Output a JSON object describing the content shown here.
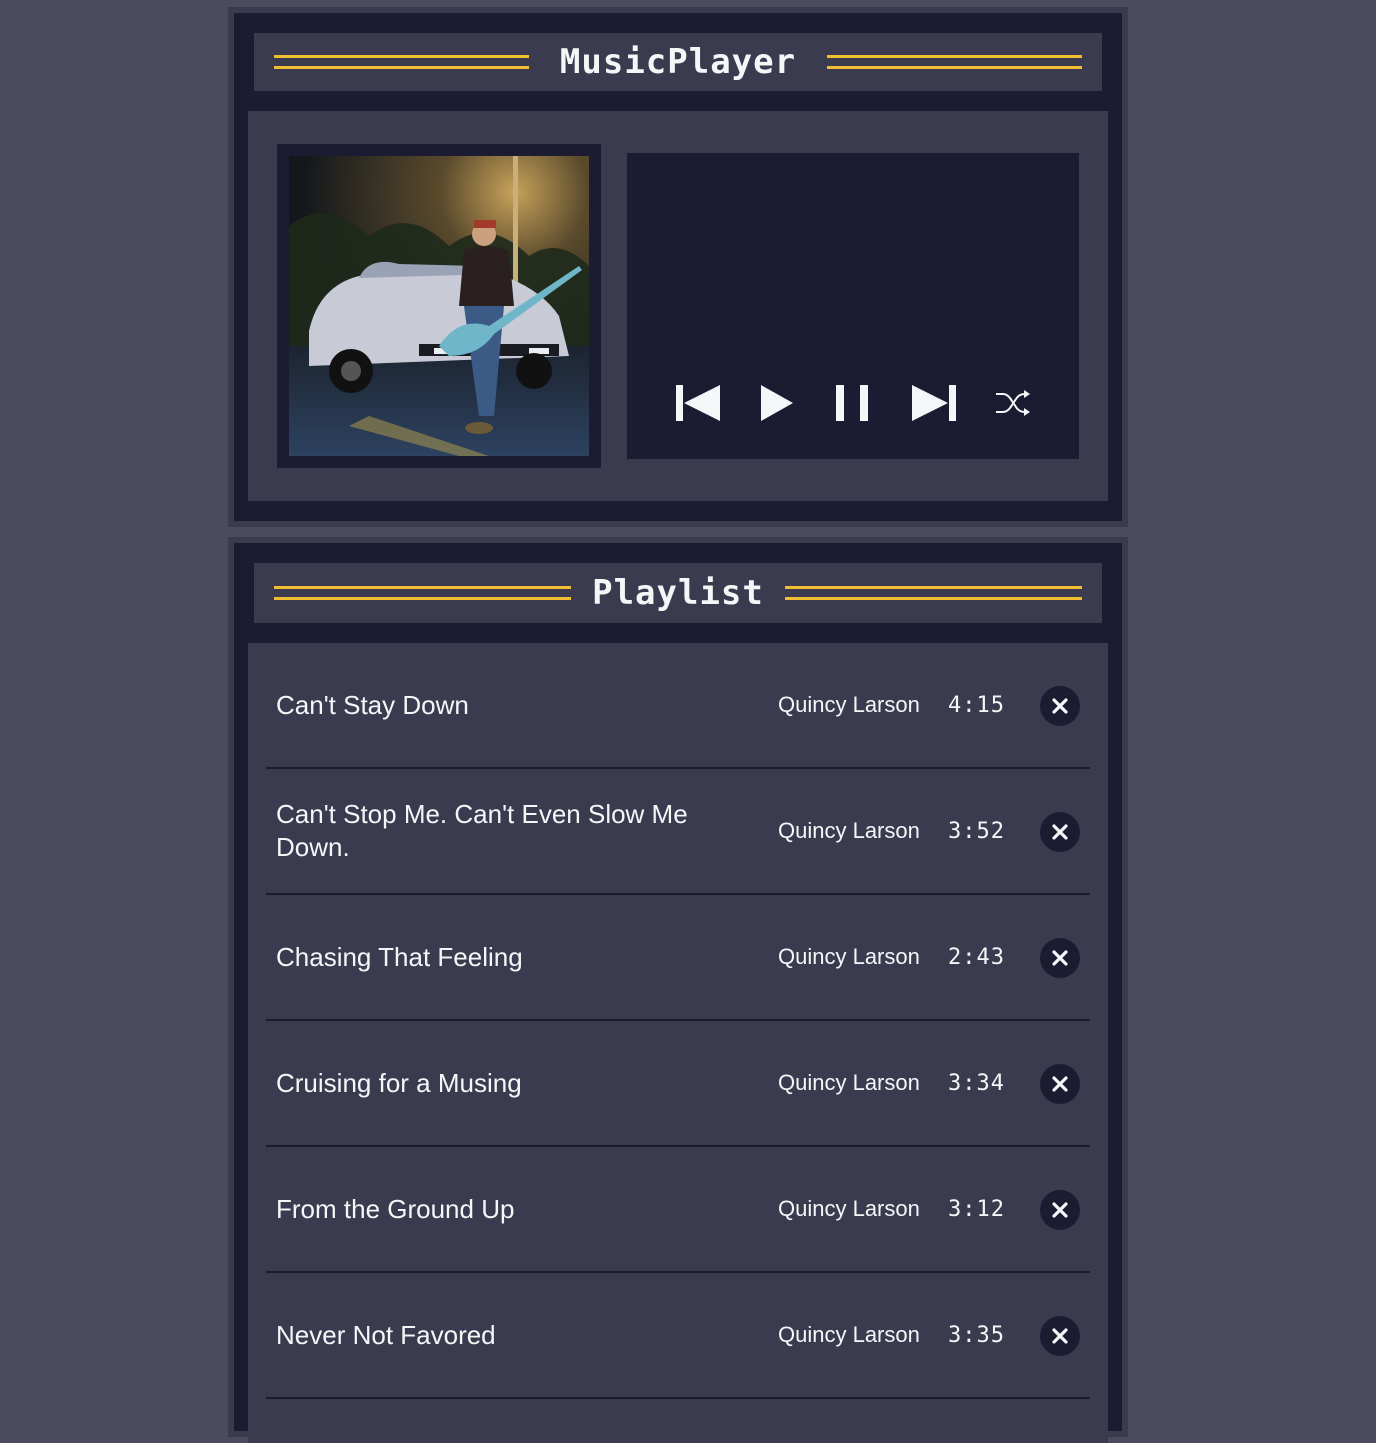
{
  "player": {
    "title": "MusicPlayer",
    "album_art_alt": "song cover art",
    "controls": {
      "previous": "previous-icon",
      "play": "play-icon",
      "pause": "pause-icon",
      "next": "next-icon",
      "shuffle": "shuffle-icon"
    }
  },
  "playlist": {
    "title": "Playlist",
    "songs": [
      {
        "title": "Can't Stay Down",
        "artist": "Quincy Larson",
        "duration": "4:15"
      },
      {
        "title": "Can't Stop Me. Can't Even Slow Me Down.",
        "artist": "Quincy Larson",
        "duration": "3:52"
      },
      {
        "title": "Chasing That Feeling",
        "artist": "Quincy Larson",
        "duration": "2:43"
      },
      {
        "title": "Cruising for a Musing",
        "artist": "Quincy Larson",
        "duration": "3:34"
      },
      {
        "title": "From the Ground Up",
        "artist": "Quincy Larson",
        "duration": "3:12"
      },
      {
        "title": "Never Not Favored",
        "artist": "Quincy Larson",
        "duration": "3:35"
      }
    ]
  },
  "colors": {
    "page_background": "#4b4b5e",
    "panel_dark": "#1b1b32",
    "panel_mid": "#3b3b4f",
    "accent": "#f1be32",
    "text": "#f5f6f7"
  }
}
